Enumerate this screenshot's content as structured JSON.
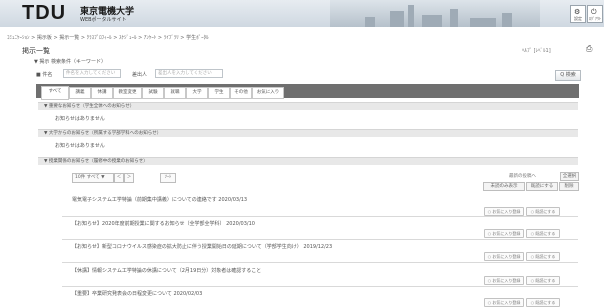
{
  "header": {
    "logo_text": "TDU",
    "logo_jp": "東京電機大学",
    "logo_sub": "WEBポータルサイト",
    "icons": [
      {
        "name": "settings-icon",
        "label": "設定"
      },
      {
        "name": "logout-icon",
        "label": "ﾛｸﾞｱｳﾄ"
      }
    ]
  },
  "breadcrumb": "ｺﾐｭﾆｹｰｼｮﾝ > 掲示板 > 掲示一覧 > ｸﾗｽﾌﾟﾛﾌｨｰﾙ > ｽｹｼﾞｭｰﾙ > ｱﾝｹｰﾄ > ﾗｲﾌﾞﾗﾘ > 学生ﾎﾟｰﾀﾙ",
  "page": {
    "title": "掲示一覧",
    "right_label": "ﾍﾙﾌﾟ [ﾚﾍﾞﾙ1]"
  },
  "search": {
    "section_title": "▼ 掲示 検索条件（キーワード）",
    "label_keyword": "■ 件名",
    "keyword_placeholder": "件名を入力してください",
    "label_sender": "差出人",
    "sender_placeholder": "差出人を入力してください",
    "button_label": "Q 検索"
  },
  "tabs": [
    {
      "label": "すべて",
      "active": true
    },
    {
      "label": "講義"
    },
    {
      "label": "休講"
    },
    {
      "label": "教室変更"
    },
    {
      "label": "試験"
    },
    {
      "label": "就職"
    },
    {
      "label": "大学"
    },
    {
      "label": "学生"
    },
    {
      "label": "その他"
    },
    {
      "label": "お気に入り"
    }
  ],
  "sections": [
    {
      "heading": "▼ 重要なお知らせ（学生全体へのお知らせ）",
      "content": "お知らせはありません"
    },
    {
      "heading": "▼ 大学からのお知らせ（所属する学部学科へのお知らせ）",
      "content": "お知らせはありません"
    },
    {
      "heading": "▼ 授業関係のお知らせ（履修中の授業のお知らせ）"
    }
  ],
  "list_controls": {
    "page_size": "10件 すべて ▼",
    "prev": "＜",
    "next": "＞",
    "filter_label": "ｿｰﾄ",
    "right_note": "最新の投稿へ",
    "right_button": "全選択",
    "sub_buttons": [
      "未読のみ表示",
      "既読にする",
      "削除"
    ]
  },
  "items": [
    {
      "title": "電気電子システム工学特論（前期集中講義）についての連絡です  2020/03/13",
      "buttons": [
        "○ お気に入り登録",
        "○ 既読にする"
      ]
    },
    {
      "title": "【お知らせ】2020年度前期授業に関するお知らせ（全学部全学科）  2020/03/10",
      "buttons": [
        "○ お気に入り登録",
        "○ 既読にする"
      ]
    },
    {
      "title": "【お知らせ】新型コロナウイルス感染症の拡大防止に伴う授業開始日の延期について（学部学生向け）  2019/12/23",
      "buttons": [
        "○ お気に入り登録",
        "○ 既読にする"
      ]
    },
    {
      "title": "【休講】情報システム工学特論の休講について（2月19日分）対象者は確認すること",
      "buttons": [
        "○ お気に入り登録",
        "○ 既読にする"
      ]
    },
    {
      "title": "【重要】卒業研究発表会の日程変更について  2020/02/03",
      "buttons": [
        "○ お気に入り登録",
        "○ 既読にする"
      ]
    }
  ]
}
